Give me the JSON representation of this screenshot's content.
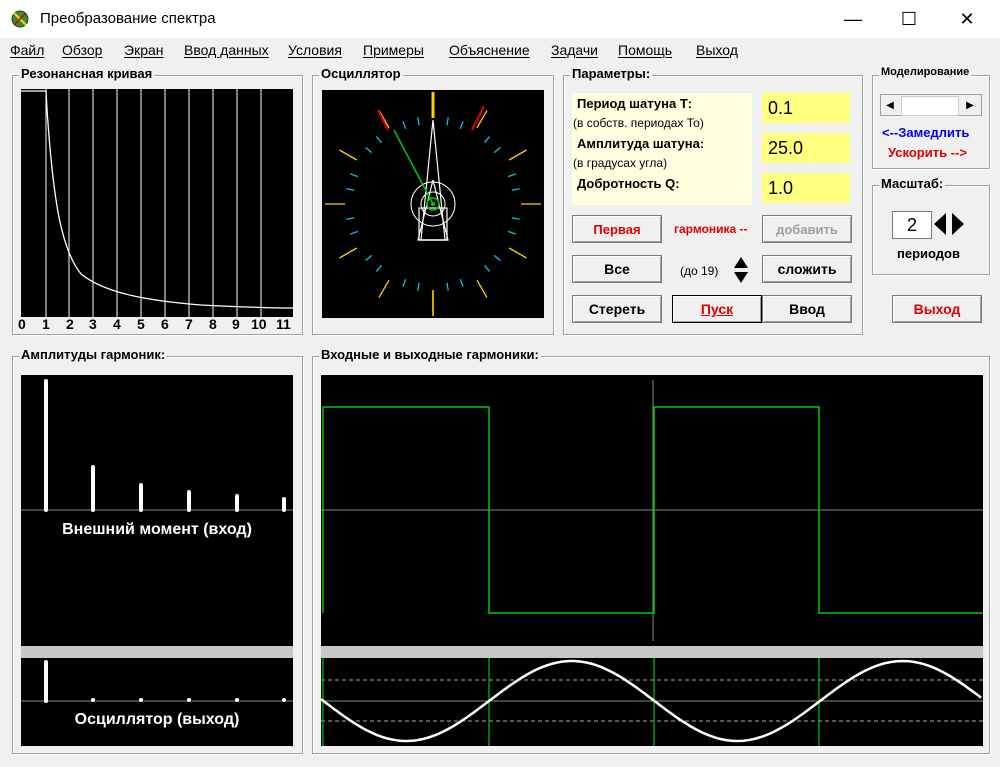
{
  "window": {
    "title": "Преобразование спектра",
    "minimize": "—",
    "maximize": "☐",
    "close": "✕"
  },
  "menu": [
    "Файл",
    "Обзор",
    "Экран",
    "Ввод данных",
    "Условия",
    "Примеры",
    "Объяснение",
    "Задачи",
    "Помощь",
    "Выход"
  ],
  "resonance": {
    "title": "Резонансная кривая",
    "ticks": [
      "0",
      "1",
      "2",
      "3",
      "4",
      "5",
      "6",
      "7",
      "8",
      "9",
      "10",
      "11"
    ]
  },
  "oscillator": {
    "title": "Осциллятор"
  },
  "params": {
    "title": "Параметры:",
    "period_label": "Период шатуна Т:",
    "period_hint": "(в собств. периодах То)",
    "period_value": "0.1",
    "amplitude_label": "Амплитуда шатуна:",
    "amplitude_hint": "(в градусах угла)",
    "amplitude_value": "25.0",
    "quality_label": "Добротность Q:",
    "quality_value": "1.0",
    "first_button": "Первая",
    "harmonic_text": "гармоника --",
    "add_button": "добавить",
    "all_button": "Все",
    "upto_text": "(до 19)",
    "sum_button": "сложить",
    "erase_button": "Стереть",
    "start_button": "Пуск",
    "enter_button": "Ввод"
  },
  "simulation": {
    "title": "Моделирование",
    "slower": "<--Замедлить",
    "faster": "Ускорить -->"
  },
  "scale": {
    "title": "Масштаб:",
    "value": "2",
    "unit": "периодов"
  },
  "exit_button": "Выход",
  "harmonics_amp": {
    "title": "Амплитуды гармоник:",
    "input_label": "Внешний момент (вход)",
    "output_label": "Осциллятор (выход)"
  },
  "io_harmonics": {
    "title": "Входные и выходные гармоники:"
  },
  "colors": {
    "accent_red": "#e00000",
    "accent_blue": "#0000ff",
    "field_yellow": "#ffff80",
    "signal_green": "#00c800"
  }
}
